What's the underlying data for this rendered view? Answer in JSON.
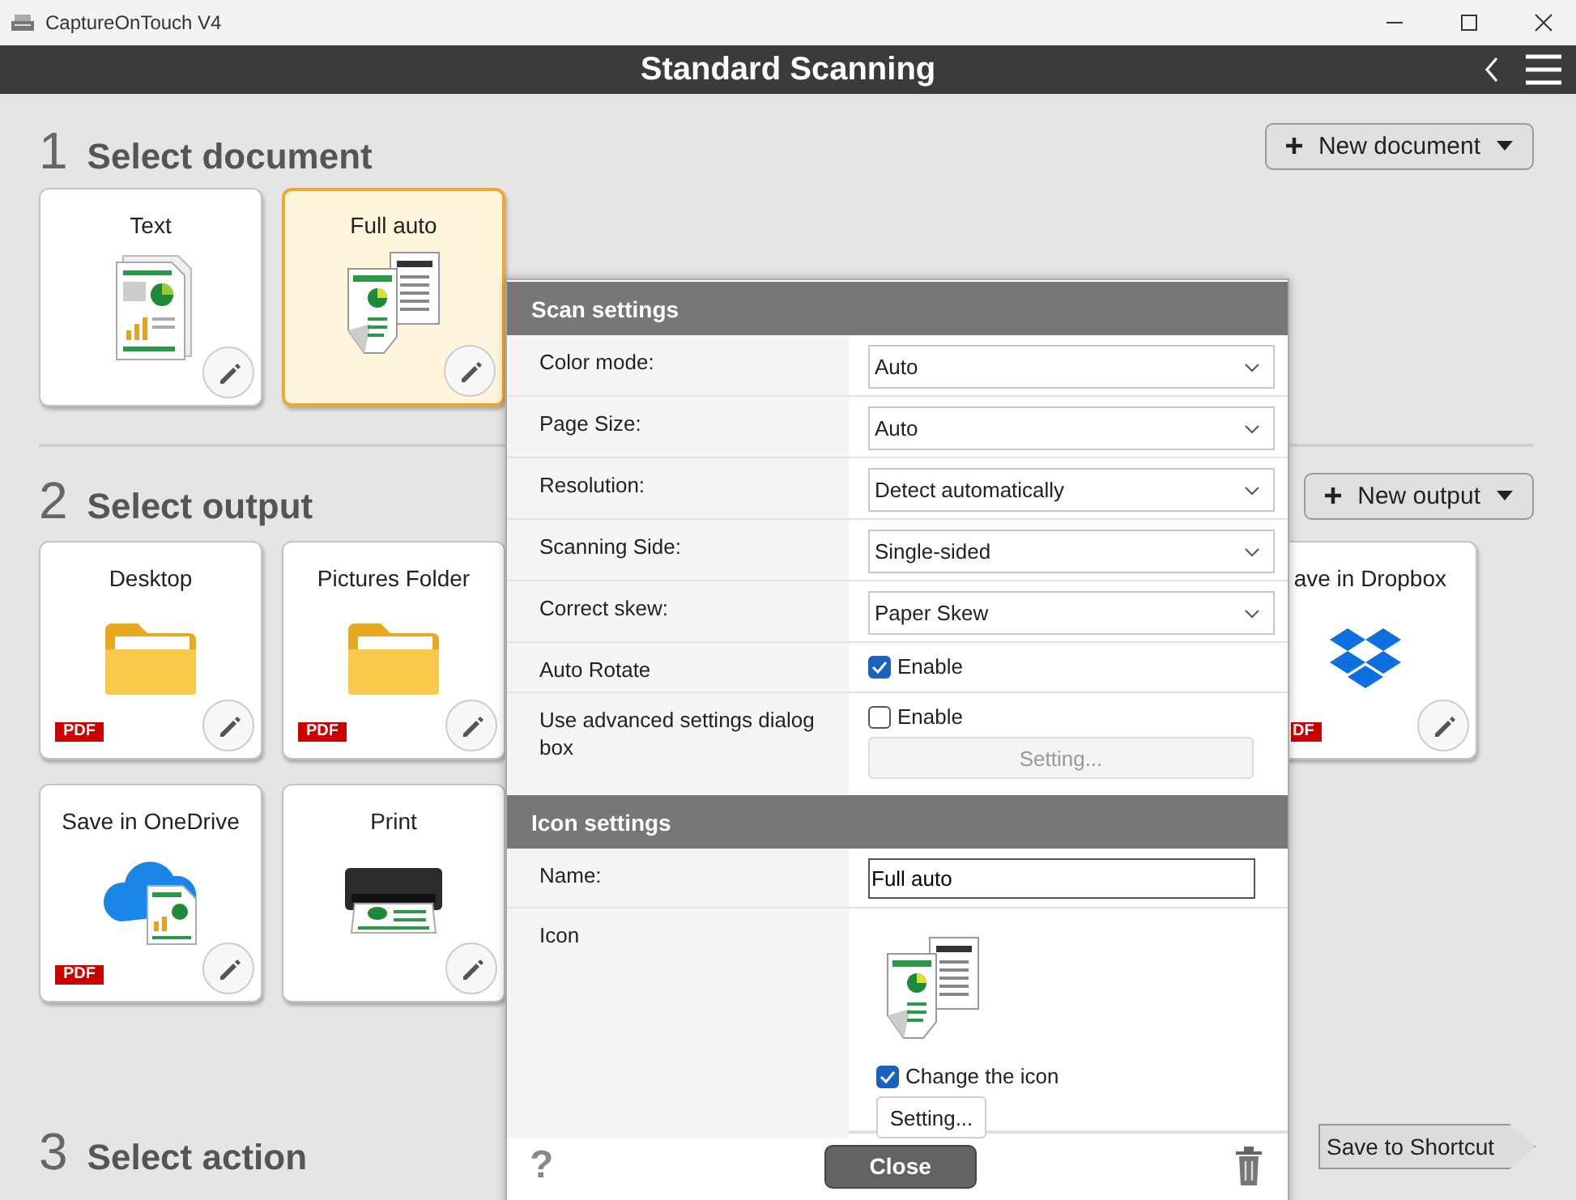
{
  "window": {
    "title": "CaptureOnTouch V4"
  },
  "header": {
    "title": "Standard Scanning"
  },
  "sections": [
    {
      "number": "1",
      "title": "Select document",
      "add_button": "New document",
      "card_rows": [
        {
          "cards": [
            {
              "label": "Text",
              "kind": "document",
              "selected": false,
              "partial": false
            },
            {
              "label": "Full auto",
              "kind": "scan",
              "selected": true,
              "partial": false
            }
          ]
        }
      ]
    },
    {
      "number": "2",
      "title": "Select output",
      "add_button": "New output",
      "card_rows": [
        {
          "cards": [
            {
              "label": "Desktop",
              "kind": "folder",
              "badge": "PDF",
              "selected": false,
              "partial": false
            },
            {
              "label": "Pictures Folder",
              "kind": "folder",
              "badge": "PDF",
              "selected": false,
              "partial": false
            },
            {
              "label": "ave in Dropbox",
              "kind": "dropbox",
              "badge": "DF",
              "selected": false,
              "partial": true
            }
          ]
        },
        {
          "cards": [
            {
              "label": "Save in OneDrive",
              "kind": "cloud",
              "badge": "PDF",
              "selected": false,
              "partial": false
            },
            {
              "label": "Print",
              "kind": "printer",
              "selected": false,
              "partial": false
            }
          ]
        }
      ]
    },
    {
      "number": "3",
      "title": "Select action",
      "action_button": "Save to Shortcut"
    }
  ],
  "popup": {
    "panels": [
      {
        "title": "Scan settings",
        "rows": [
          {
            "kind": "select",
            "label": "Color mode:",
            "value": "Auto"
          },
          {
            "kind": "select",
            "label": "Page Size:",
            "value": "Auto"
          },
          {
            "kind": "select",
            "label": "Resolution:",
            "value": "Detect automatically"
          },
          {
            "kind": "select",
            "label": "Scanning Side:",
            "value": "Single-sided"
          },
          {
            "kind": "select",
            "label": "Correct skew:",
            "value": "Paper Skew"
          },
          {
            "kind": "checkbox",
            "label": "Auto Rotate",
            "option": "Enable",
            "checked": true
          },
          {
            "kind": "checkbox",
            "label": "Use advanced settings dialog box",
            "option": "Enable",
            "checked": false,
            "button": "Setting...",
            "button_disabled": true
          }
        ]
      },
      {
        "title": "Icon settings",
        "rows": [
          {
            "kind": "text",
            "label": "Name:",
            "value": "Full auto"
          },
          {
            "kind": "icon",
            "label": "Icon",
            "option": "Change the icon",
            "checked": true,
            "button": "Setting...",
            "button_disabled": false
          }
        ]
      }
    ],
    "help": "?",
    "close_button": "Close"
  }
}
